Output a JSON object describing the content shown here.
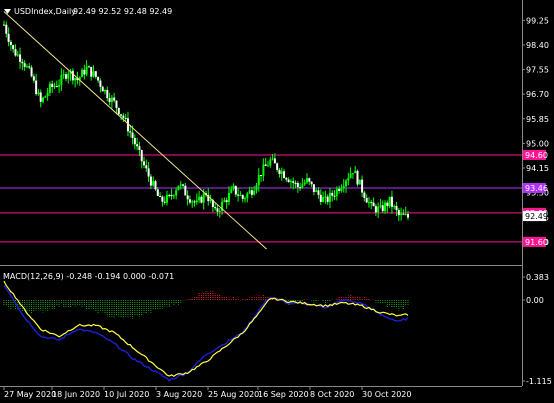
{
  "header": {
    "symbol_label": "USDIndex,Daily",
    "ohlc_label": "92.49 92.52 92.48 92.49",
    "collapse_icon": "triangle-down-icon"
  },
  "macd": {
    "label": "MACD(12,26,9) -0.248 -0.194 0.000 -0.071"
  },
  "colors": {
    "background": "#000000",
    "bull_candle": "#00ff00",
    "bear_candle": "#ffffff",
    "trendline": "#f0e68c",
    "magenta_level": "#ff1493",
    "purple_level": "#b030ff",
    "macd_up": "#e02020",
    "macd_down": "#20a020",
    "macd_line": "#1e1ed6",
    "signal_line": "#ffff40",
    "axis_text": "#ffffff",
    "separator": "#888888"
  },
  "chart_data": {
    "type": "candlestick",
    "price_axis_ticks": [
      "99.25",
      "98.40",
      "97.55",
      "96.70",
      "95.85",
      "95.00",
      "94.15",
      "93.30",
      "92.45",
      "91.60"
    ],
    "time_axis_ticks": [
      "27 May 2020",
      "18 Jun 2020",
      "10 Jul 2020",
      "3 Aug 2020",
      "25 Aug 2020",
      "16 Sep 2020",
      "8 Oct 2020",
      "30 Oct 2020"
    ],
    "macd_axis_ticks": [
      "0.383",
      "0.00",
      "-1.115"
    ],
    "levels": [
      {
        "value": 94.6,
        "label": "94.60",
        "color": "magenta"
      },
      {
        "value": 93.46,
        "label": "93.46",
        "color": "purple"
      },
      {
        "value": 92.6,
        "label": "92.60",
        "color": "magenta"
      },
      {
        "value": 91.6,
        "label": "91.60",
        "color": "magenta"
      }
    ],
    "current_price": {
      "value": 92.49,
      "label": "92.49"
    },
    "trendline": {
      "from": {
        "date": "27 May 2020",
        "price": 99.55
      },
      "to": {
        "date": "16 Sep 2020",
        "price": 91.35
      }
    },
    "close_path": [
      [
        0,
        99.1
      ],
      [
        4,
        98.2
      ],
      [
        8,
        97.9
      ],
      [
        12,
        97.3
      ],
      [
        16,
        96.4
      ],
      [
        20,
        96.9
      ],
      [
        24,
        97.1
      ],
      [
        28,
        97.5
      ],
      [
        32,
        97.2
      ],
      [
        36,
        97.6
      ],
      [
        40,
        97.3
      ],
      [
        44,
        96.8
      ],
      [
        48,
        96.4
      ],
      [
        52,
        95.9
      ],
      [
        56,
        95.2
      ],
      [
        60,
        94.4
      ],
      [
        64,
        93.7
      ],
      [
        68,
        93.0
      ],
      [
        72,
        93.1
      ],
      [
        76,
        93.6
      ],
      [
        80,
        93.2
      ],
      [
        84,
        92.9
      ],
      [
        88,
        93.3
      ],
      [
        92,
        92.6
      ],
      [
        96,
        93.0
      ],
      [
        100,
        93.4
      ],
      [
        104,
        93.1
      ],
      [
        108,
        93.4
      ],
      [
        112,
        94.0
      ],
      [
        116,
        94.4
      ],
      [
        120,
        94.1
      ],
      [
        124,
        93.8
      ],
      [
        128,
        93.5
      ],
      [
        132,
        93.7
      ],
      [
        136,
        93.3
      ],
      [
        140,
        93.0
      ],
      [
        144,
        93.3
      ],
      [
        148,
        93.7
      ],
      [
        152,
        94.1
      ],
      [
        156,
        93.4
      ],
      [
        160,
        92.8
      ],
      [
        164,
        92.7
      ],
      [
        168,
        93.0
      ],
      [
        172,
        92.5
      ],
      [
        176,
        92.45
      ]
    ],
    "macd_path": [
      [
        0,
        0.25
      ],
      [
        8,
        -0.2
      ],
      [
        16,
        -0.5
      ],
      [
        24,
        -0.55
      ],
      [
        32,
        -0.4
      ],
      [
        40,
        -0.45
      ],
      [
        48,
        -0.6
      ],
      [
        56,
        -0.8
      ],
      [
        64,
        -0.95
      ],
      [
        72,
        -1.1
      ],
      [
        80,
        -1.0
      ],
      [
        88,
        -0.75
      ],
      [
        96,
        -0.6
      ],
      [
        104,
        -0.45
      ],
      [
        112,
        -0.1
      ],
      [
        116,
        0.05
      ],
      [
        124,
        -0.05
      ],
      [
        132,
        -0.05
      ],
      [
        140,
        -0.1
      ],
      [
        148,
        0.0
      ],
      [
        156,
        -0.05
      ],
      [
        164,
        -0.2
      ],
      [
        172,
        -0.3
      ],
      [
        176,
        -0.25
      ]
    ],
    "signal_path": [
      [
        0,
        0.3
      ],
      [
        8,
        -0.1
      ],
      [
        16,
        -0.4
      ],
      [
        24,
        -0.5
      ],
      [
        32,
        -0.35
      ],
      [
        40,
        -0.35
      ],
      [
        48,
        -0.45
      ],
      [
        56,
        -0.65
      ],
      [
        64,
        -0.85
      ],
      [
        72,
        -1.05
      ],
      [
        80,
        -1.0
      ],
      [
        88,
        -0.85
      ],
      [
        96,
        -0.65
      ],
      [
        104,
        -0.45
      ],
      [
        112,
        -0.15
      ],
      [
        116,
        0.03
      ],
      [
        124,
        -0.02
      ],
      [
        132,
        -0.05
      ],
      [
        140,
        -0.08
      ],
      [
        148,
        -0.04
      ],
      [
        156,
        -0.08
      ],
      [
        164,
        -0.17
      ],
      [
        172,
        -0.22
      ],
      [
        176,
        -0.2
      ]
    ]
  }
}
